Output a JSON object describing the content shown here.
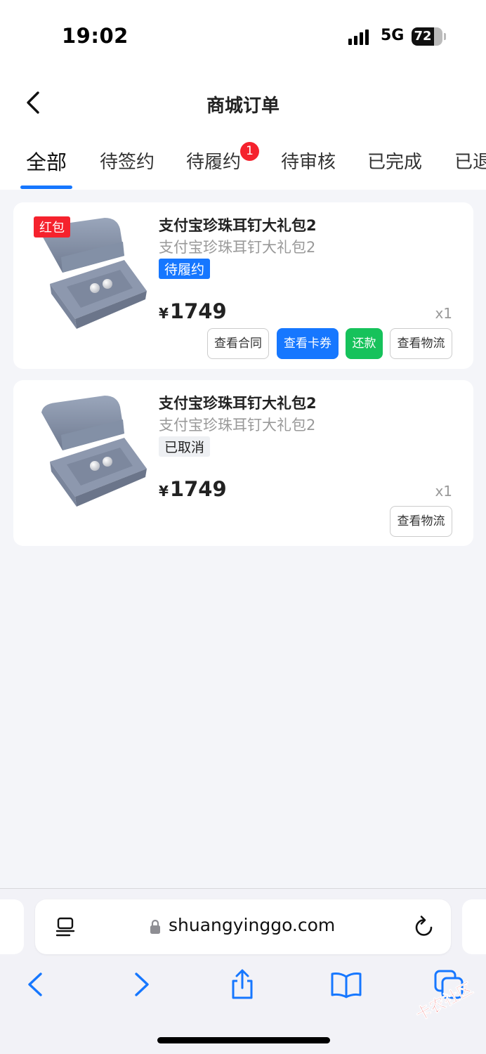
{
  "status_bar": {
    "time": "19:02",
    "network": "5G",
    "battery": "72",
    "battery_level": 0.72
  },
  "header": {
    "title": "商城订单"
  },
  "tabs": [
    {
      "label": "全部",
      "active": true
    },
    {
      "label": "待签约"
    },
    {
      "label": "待履约",
      "badge": "1"
    },
    {
      "label": "待审核"
    },
    {
      "label": "已完成"
    },
    {
      "label": "已退"
    }
  ],
  "orders": [
    {
      "tag": "红包",
      "title": "支付宝珍珠耳钉大礼包2",
      "subtitle": "支付宝珍珠耳钉大礼包2",
      "status": "待履约",
      "currency": "¥",
      "price": "1749",
      "qty": "x1",
      "buttons": [
        "查看合同",
        "查看卡券",
        "还款",
        "查看物流"
      ]
    },
    {
      "title": "支付宝珍珠耳钉大礼包2",
      "subtitle": "支付宝珍珠耳钉大礼包2",
      "status": "已取消",
      "currency": "¥",
      "price": "1749",
      "qty": "x1",
      "buttons": [
        "查看物流"
      ]
    }
  ],
  "browser": {
    "url": "shuangyinggo.com"
  },
  "watermark": "卡农社区",
  "icons": {
    "back": "chevron-left-icon",
    "reader": "reader-mode-icon",
    "lock": "lock-icon",
    "reload": "reload-icon",
    "nav_back": "back-arrow-icon",
    "nav_forward": "forward-arrow-icon",
    "share": "share-icon",
    "bookmarks": "bookmarks-icon",
    "tabs": "tabs-icon"
  },
  "colors": {
    "accent": "#1677ff",
    "danger": "#f5222d",
    "success": "#16c25b"
  }
}
